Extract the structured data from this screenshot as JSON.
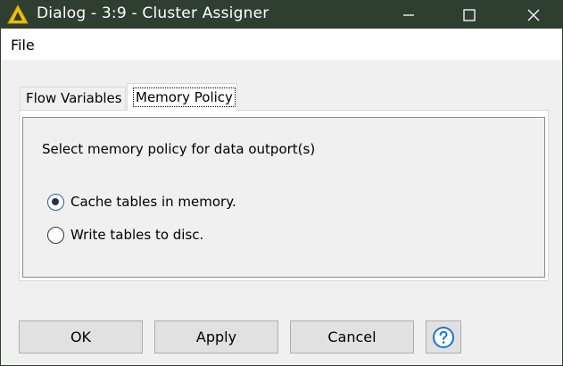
{
  "window": {
    "title": "Dialog - 3:9 - Cluster Assigner",
    "controls": [
      "minimize-icon",
      "maximize-icon",
      "close-icon"
    ]
  },
  "menubar": {
    "items": [
      {
        "label": "File"
      }
    ]
  },
  "tabs": [
    {
      "label": "Flow Variables",
      "selected": false
    },
    {
      "label": "Memory Policy",
      "selected": true
    }
  ],
  "memory_policy": {
    "heading": "Select memory policy for data outport(s)",
    "options": [
      {
        "label": "Cache tables in memory.",
        "checked": true
      },
      {
        "label": "Write tables to disc.",
        "checked": false
      }
    ]
  },
  "buttons": {
    "ok": "OK",
    "apply": "Apply",
    "cancel": "Cancel",
    "help_icon": "help-icon"
  },
  "colors": {
    "titlebar": "#2f3f2f",
    "app_icon": "#f2c200",
    "radio_accent": "#1f5fa8",
    "help_accent": "#1a73d9"
  }
}
